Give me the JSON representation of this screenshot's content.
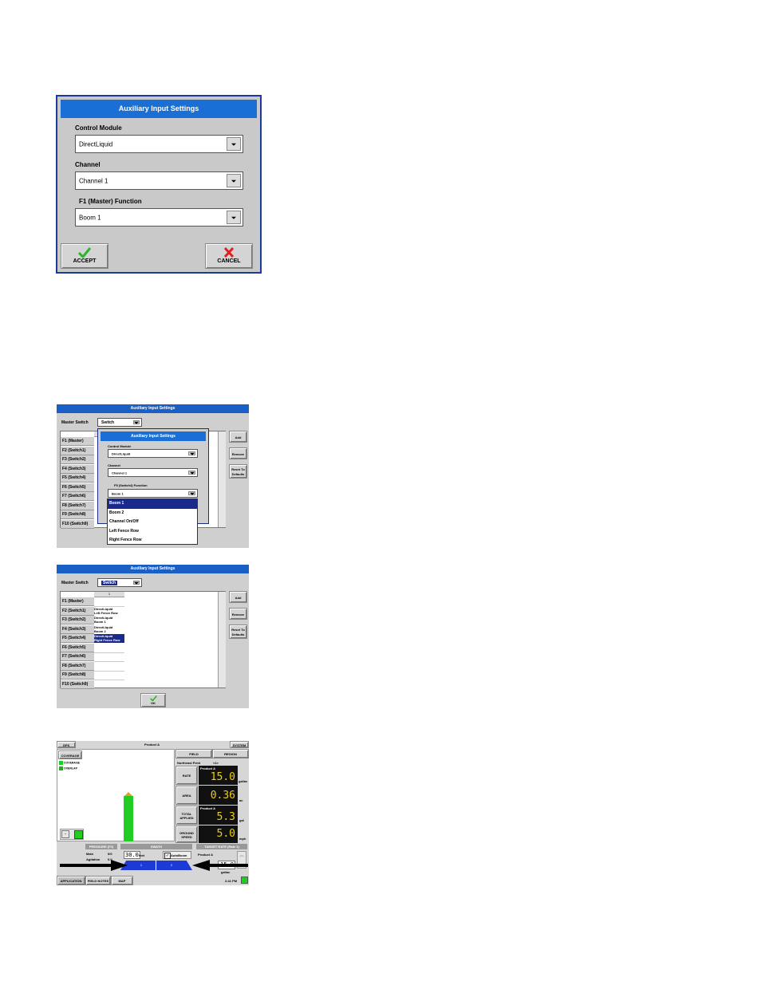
{
  "dialog1": {
    "title": "Auxiliary Input Settings",
    "control_module_label": "Control Module",
    "control_module_value": "DirectLiquid",
    "channel_label": "Channel",
    "channel_value": "Channel 1",
    "function_label": "F1 (Master) Function",
    "function_value": "Boom 1",
    "accept_label": "ACCEPT",
    "cancel_label": "CANCEL"
  },
  "screen2": {
    "title": "Auxiliary Input Settings",
    "master_switch_label": "Master Switch",
    "master_switch_value": "Switch",
    "col_header": "1",
    "rows": [
      "F1 (Master)",
      "F2 (Switch1)",
      "F3 (Switch2)",
      "F4 (Switch3)",
      "F5 (Switch4)",
      "F6 (Switch5)",
      "F7 (Switch6)",
      "F8 (Switch7)",
      "F9 (Switch8)",
      "F10 (Switch9)"
    ],
    "side_buttons": [
      "Add",
      "Remove",
      "Reset To Defaults"
    ],
    "popup": {
      "title": "Auxiliary Input Settings",
      "control_module_label": "Control Module",
      "control_module_value": "DirectLiquid",
      "channel_label": "Channel",
      "channel_value": "Channel 1",
      "function_label": "F5 (Switch4) Function",
      "function_value": "Boom 1",
      "options": [
        "Boom 1",
        "Boom 2",
        "Channel On/Off",
        "Left Fence Row",
        "Right Fence Row"
      ],
      "selected_option": "Boom 1"
    }
  },
  "screen3": {
    "title": "Auxiliary Input Settings",
    "master_switch_label": "Master Switch",
    "master_switch_value": "Switch",
    "col_header": "1",
    "rows": [
      "F1 (Master)",
      "F2 (Switch1)",
      "F3 (Switch2)",
      "F4 (Switch3)",
      "F5 (Switch4)",
      "F6 (Switch5)",
      "F7 (Switch6)",
      "F8 (Switch7)",
      "F9 (Switch8)",
      "F10 (Switch9)"
    ],
    "cells": [
      "",
      "DirectLiquid\nLeft Fence Row",
      "DirectLiquid\nBoom 1",
      "DirectLiquid\nBoom 2",
      "DirectLiquid\nRight Fence Row",
      "",
      "",
      "",
      "",
      ""
    ],
    "side_buttons": [
      "Add",
      "Remove",
      "Reset To Defaults"
    ],
    "ok_label": "OK"
  },
  "screen4": {
    "gps_label": "GPS",
    "product_title": "Product A",
    "system_label": "SYSTEM",
    "coverage_btn": "COVERAGE",
    "legend": [
      {
        "label": "COVERAGE",
        "color": "#22cc22"
      },
      {
        "label": "OVERLAP",
        "color": "#22aa22"
      }
    ],
    "field_btn": "FIELD",
    "region_btn": "REGION",
    "field_name_label": "Northeast Field",
    "field_name_value": "<1>",
    "readouts": [
      {
        "label": "RATE",
        "product": "Product A",
        "value": "15.0",
        "unit": "gal/ac"
      },
      {
        "label": "AREA",
        "product": "",
        "value": "0.36",
        "unit": "ac"
      },
      {
        "label": "TOTAL APPLIED",
        "product": "Product A",
        "value": "5.3",
        "unit": "gal"
      },
      {
        "label": "GROUND SPEED",
        "product": "",
        "value": "5.0",
        "unit": "mph"
      }
    ],
    "pressure_header": "PRESSURE (F2)",
    "pressure_rows": [
      {
        "k": "Main",
        "v": "0/0"
      },
      {
        "k": "Agitation",
        "v": "0.0"
      }
    ],
    "swath_header": "SWATH",
    "swath_value": "30.0",
    "swath_unit": "feet",
    "autoboom_label": "AutoBoom",
    "sections": [
      "1",
      "2"
    ],
    "target_header": "TARGET RATE (Rate 1)",
    "target_product": "Product A",
    "target_value": "15.0",
    "target_unit": "gal/ac",
    "tabs": [
      "APPLICATION",
      "FIELD NOTES",
      "MAP"
    ],
    "clock": "2:41 PM",
    "colors": {
      "green": "#22cc22",
      "blue": "#1c3ad6",
      "display": "#f0d000"
    }
  }
}
